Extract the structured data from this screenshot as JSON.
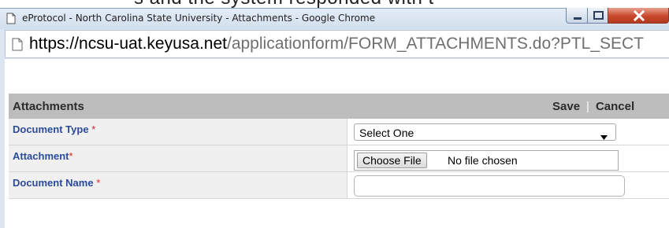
{
  "top_fragment": "s and the system responded with t",
  "window": {
    "title": "eProtocol - North Carolina State University - Attachments - Google Chrome"
  },
  "address": {
    "host": "https://ncsu-uat.keyusa.net",
    "path": "/applicationform/FORM_ATTACHMENTS.do?PTL_SECT"
  },
  "header": {
    "title": "Attachments",
    "save_label": "Save",
    "separator": "|",
    "cancel_label": "Cancel"
  },
  "form": {
    "document_type": {
      "label": "Document Type",
      "required_mark": "*",
      "selected": "Select One"
    },
    "attachment": {
      "label": "Attachment",
      "required_mark": "*",
      "button_label": "Choose File",
      "status": "No file chosen"
    },
    "document_name": {
      "label": "Document Name",
      "required_mark": "*",
      "value": ""
    }
  },
  "colors": {
    "label_blue": "#2a4b9a",
    "required_red": "#dd2222",
    "header_gray": "#bdbdbd",
    "close_red": "#c8482c"
  },
  "icons": [
    "page-icon",
    "minimize-icon",
    "maximize-icon",
    "close-icon",
    "dropdown-caret-icon"
  ]
}
